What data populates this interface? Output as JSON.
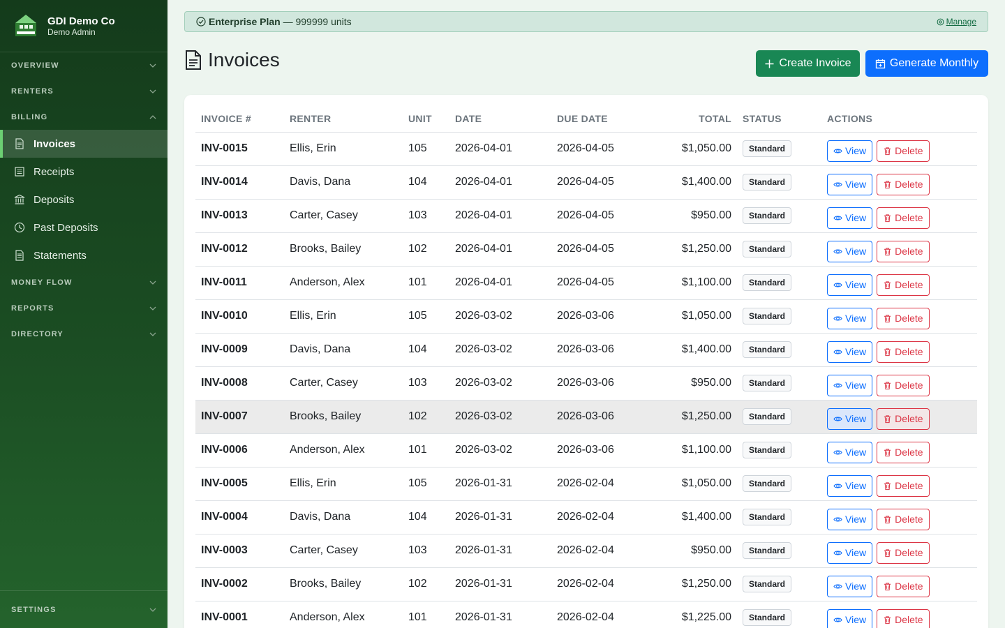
{
  "app": {
    "company": "GDI Demo Co",
    "role": "Demo Admin",
    "logo_icon": "building-logo-icon"
  },
  "sidebar": {
    "sections_top": [
      {
        "label": "OVERVIEW"
      },
      {
        "label": "RENTERS"
      },
      {
        "label": "BILLING"
      }
    ],
    "billing_items": [
      {
        "label": "Invoices",
        "icon": "file-text-icon",
        "active": true
      },
      {
        "label": "Receipts",
        "icon": "receipt-icon"
      },
      {
        "label": "Deposits",
        "icon": "bank-icon"
      },
      {
        "label": "Past Deposits",
        "icon": "clock-history-icon"
      },
      {
        "label": "Statements",
        "icon": "document-icon"
      }
    ],
    "sections_bottom": [
      {
        "label": "MONEY FLOW"
      },
      {
        "label": "REPORTS"
      },
      {
        "label": "DIRECTORY"
      }
    ],
    "settings_label": "SETTINGS"
  },
  "banner": {
    "plan": "Enterprise Plan",
    "units": "— 999999 units",
    "manage": "Manage"
  },
  "page": {
    "title": "Invoices"
  },
  "buttons": {
    "create": "Create Invoice",
    "generate": "Generate Monthly"
  },
  "table": {
    "headers": {
      "invoice": "INVOICE #",
      "renter": "RENTER",
      "unit": "UNIT",
      "date": "DATE",
      "due": "DUE DATE",
      "total": "TOTAL",
      "status": "STATUS",
      "actions": "ACTIONS"
    },
    "view_label": "View",
    "delete_label": "Delete",
    "rows": [
      {
        "invoice": "INV-0015",
        "renter": "Ellis, Erin",
        "unit": "105",
        "date": "2026-04-01",
        "due": "2026-04-05",
        "total": "$1,050.00",
        "status": "Standard"
      },
      {
        "invoice": "INV-0014",
        "renter": "Davis, Dana",
        "unit": "104",
        "date": "2026-04-01",
        "due": "2026-04-05",
        "total": "$1,400.00",
        "status": "Standard"
      },
      {
        "invoice": "INV-0013",
        "renter": "Carter, Casey",
        "unit": "103",
        "date": "2026-04-01",
        "due": "2026-04-05",
        "total": "$950.00",
        "status": "Standard"
      },
      {
        "invoice": "INV-0012",
        "renter": "Brooks, Bailey",
        "unit": "102",
        "date": "2026-04-01",
        "due": "2026-04-05",
        "total": "$1,250.00",
        "status": "Standard"
      },
      {
        "invoice": "INV-0011",
        "renter": "Anderson, Alex",
        "unit": "101",
        "date": "2026-04-01",
        "due": "2026-04-05",
        "total": "$1,100.00",
        "status": "Standard"
      },
      {
        "invoice": "INV-0010",
        "renter": "Ellis, Erin",
        "unit": "105",
        "date": "2026-03-02",
        "due": "2026-03-06",
        "total": "$1,050.00",
        "status": "Standard"
      },
      {
        "invoice": "INV-0009",
        "renter": "Davis, Dana",
        "unit": "104",
        "date": "2026-03-02",
        "due": "2026-03-06",
        "total": "$1,400.00",
        "status": "Standard"
      },
      {
        "invoice": "INV-0008",
        "renter": "Carter, Casey",
        "unit": "103",
        "date": "2026-03-02",
        "due": "2026-03-06",
        "total": "$950.00",
        "status": "Standard"
      },
      {
        "invoice": "INV-0007",
        "renter": "Brooks, Bailey",
        "unit": "102",
        "date": "2026-03-02",
        "due": "2026-03-06",
        "total": "$1,250.00",
        "status": "Standard",
        "hover": true
      },
      {
        "invoice": "INV-0006",
        "renter": "Anderson, Alex",
        "unit": "101",
        "date": "2026-03-02",
        "due": "2026-03-06",
        "total": "$1,100.00",
        "status": "Standard"
      },
      {
        "invoice": "INV-0005",
        "renter": "Ellis, Erin",
        "unit": "105",
        "date": "2026-01-31",
        "due": "2026-02-04",
        "total": "$1,050.00",
        "status": "Standard"
      },
      {
        "invoice": "INV-0004",
        "renter": "Davis, Dana",
        "unit": "104",
        "date": "2026-01-31",
        "due": "2026-02-04",
        "total": "$1,400.00",
        "status": "Standard"
      },
      {
        "invoice": "INV-0003",
        "renter": "Carter, Casey",
        "unit": "103",
        "date": "2026-01-31",
        "due": "2026-02-04",
        "total": "$950.00",
        "status": "Standard"
      },
      {
        "invoice": "INV-0002",
        "renter": "Brooks, Bailey",
        "unit": "102",
        "date": "2026-01-31",
        "due": "2026-02-04",
        "total": "$1,250.00",
        "status": "Standard"
      },
      {
        "invoice": "INV-0001",
        "renter": "Anderson, Alex",
        "unit": "101",
        "date": "2026-01-31",
        "due": "2026-02-04",
        "total": "$1,225.00",
        "status": "Standard"
      }
    ]
  },
  "colors": {
    "sidebar": "#1b4d23",
    "primary": "#0d6efd",
    "success": "#198754",
    "danger": "#dc3545",
    "banner": "#d1e7dd"
  }
}
